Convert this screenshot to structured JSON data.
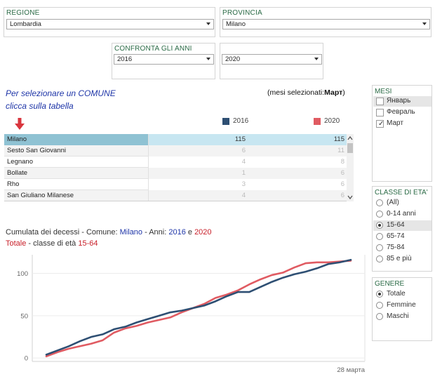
{
  "filters": {
    "regione": {
      "label": "REGIONE",
      "value": "Lombardia"
    },
    "provincia": {
      "label": "PROVINCIA",
      "value": "Milano"
    },
    "confronta": {
      "label": "CONFRONTA GLI ANNI",
      "year1": "2016",
      "year2": "2020"
    }
  },
  "hint": {
    "line1": "Per selezionare un COMUNE",
    "line2": "clicca sulla tabella"
  },
  "mesi_selezionati": {
    "open": "(mesi selezionati:",
    "value": "Март",
    "close": ")"
  },
  "legend": {
    "year1": "2016",
    "year2": "2020"
  },
  "colors": {
    "year1": "#2e4f73",
    "year2": "#e05b62",
    "selected_row": "#8fc2d3",
    "selected_cells": "#c7e6f1",
    "accent_title": "#2a6a45",
    "hint": "#1f36a8",
    "highlight_red": "#c8202a"
  },
  "table": {
    "rows": [
      {
        "name": "Milano",
        "v2016": "115",
        "v2020": "115",
        "selected": true
      },
      {
        "name": "Sesto San Giovanni",
        "v2016": "6",
        "v2020": "11",
        "selected": false
      },
      {
        "name": "Legnano",
        "v2016": "4",
        "v2020": "8",
        "selected": false
      },
      {
        "name": "Bollate",
        "v2016": "1",
        "v2020": "6",
        "selected": false
      },
      {
        "name": "Rho",
        "v2016": "3",
        "v2020": "6",
        "selected": false
      },
      {
        "name": "San Giuliano Milanese",
        "v2016": "4",
        "v2020": "6",
        "selected": false
      }
    ]
  },
  "mesi": {
    "title": "MESI",
    "options": [
      {
        "label": "Январь",
        "checked": false
      },
      {
        "label": "Февраль",
        "checked": false
      },
      {
        "label": "Март",
        "checked": true
      }
    ]
  },
  "classe_eta": {
    "title": "CLASSE DI ETA'",
    "options": [
      {
        "label": "(All)",
        "selected": false
      },
      {
        "label": "0-14 anni",
        "selected": false
      },
      {
        "label": "15-64",
        "selected": true
      },
      {
        "label": "65-74",
        "selected": false
      },
      {
        "label": "75-84",
        "selected": false
      },
      {
        "label": "85 e più",
        "selected": false
      }
    ]
  },
  "genere": {
    "title": "GENERE",
    "options": [
      {
        "label": "Totale",
        "selected": true
      },
      {
        "label": "Femmine",
        "selected": false
      },
      {
        "label": "Maschi",
        "selected": false
      }
    ]
  },
  "chart_title": {
    "prefix": "Cumulata dei decessi - Comune: ",
    "comune": "Milano",
    "mid": " - Anni: ",
    "year1": "2016",
    "and": " e ",
    "year2": "2020",
    "line2_red1": "Totale",
    "line2_mid": " - classe di età ",
    "line2_red2": "15-64"
  },
  "chart_data": {
    "type": "line",
    "x": [
      1,
      2,
      3,
      4,
      5,
      6,
      7,
      8,
      9,
      10,
      11,
      12,
      13,
      14,
      15,
      16,
      17,
      18,
      19,
      20,
      21,
      22,
      23,
      24,
      25,
      26,
      27,
      28
    ],
    "series": [
      {
        "name": "2016",
        "values": [
          4,
          9,
          14,
          20,
          25,
          28,
          34,
          37,
          42,
          46,
          50,
          54,
          56,
          59,
          62,
          67,
          73,
          78,
          78,
          84,
          90,
          95,
          99,
          102,
          106,
          111,
          113,
          116
        ]
      },
      {
        "name": "2020",
        "values": [
          2,
          7,
          11,
          14,
          17,
          21,
          30,
          35,
          38,
          42,
          45,
          48,
          54,
          59,
          64,
          71,
          75,
          80,
          87,
          93,
          98,
          101,
          107,
          112,
          113,
          113,
          114,
          115
        ]
      }
    ],
    "yticks": [
      0,
      50,
      100
    ],
    "ylim": [
      -4,
      122
    ],
    "x_end_label": "28 марта",
    "grid": true
  }
}
